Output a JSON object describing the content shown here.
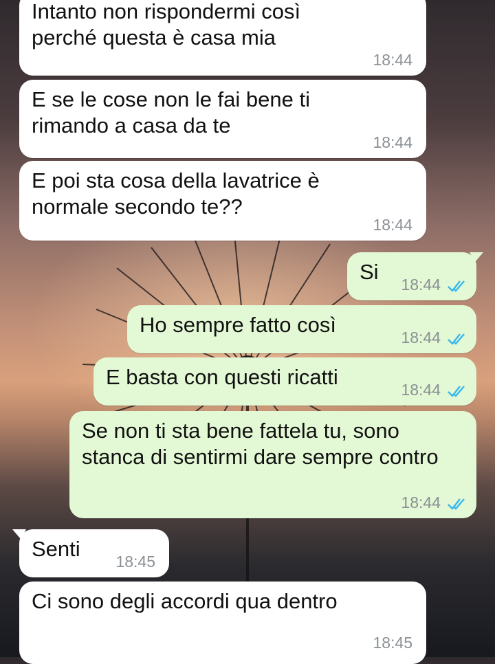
{
  "chat": {
    "messages": [
      {
        "direction": "incoming",
        "text": "Intanto non rispondermi così perché questa è casa mia",
        "time": "18:44"
      },
      {
        "direction": "incoming",
        "text": "E se le cose non le fai bene ti rimando a casa da te",
        "time": "18:44"
      },
      {
        "direction": "incoming",
        "text": "E poi sta cosa della lavatrice è normale secondo te??",
        "time": "18:44"
      },
      {
        "direction": "outgoing",
        "text": "Si",
        "time": "18:44",
        "status": "read"
      },
      {
        "direction": "outgoing",
        "text": "Ho sempre fatto così",
        "time": "18:44",
        "status": "read"
      },
      {
        "direction": "outgoing",
        "text": "E basta con questi ricatti",
        "time": "18:44",
        "status": "read"
      },
      {
        "direction": "outgoing",
        "text": "Se non ti sta bene fattela tu, sono stanca di sentirmi dare sempre contro",
        "time": "18:44",
        "status": "read"
      },
      {
        "direction": "incoming",
        "text": "Senti",
        "time": "18:45"
      },
      {
        "direction": "incoming",
        "text": "Ci sono degli accordi qua dentro",
        "time": "18:45"
      }
    ],
    "colors": {
      "incoming_bubble": "#ffffff",
      "outgoing_bubble": "#e3f8d4",
      "read_ticks": "#34b7f1",
      "timestamp": "#8a8f94"
    },
    "icons": {
      "read_receipt": "double-check-icon"
    }
  }
}
